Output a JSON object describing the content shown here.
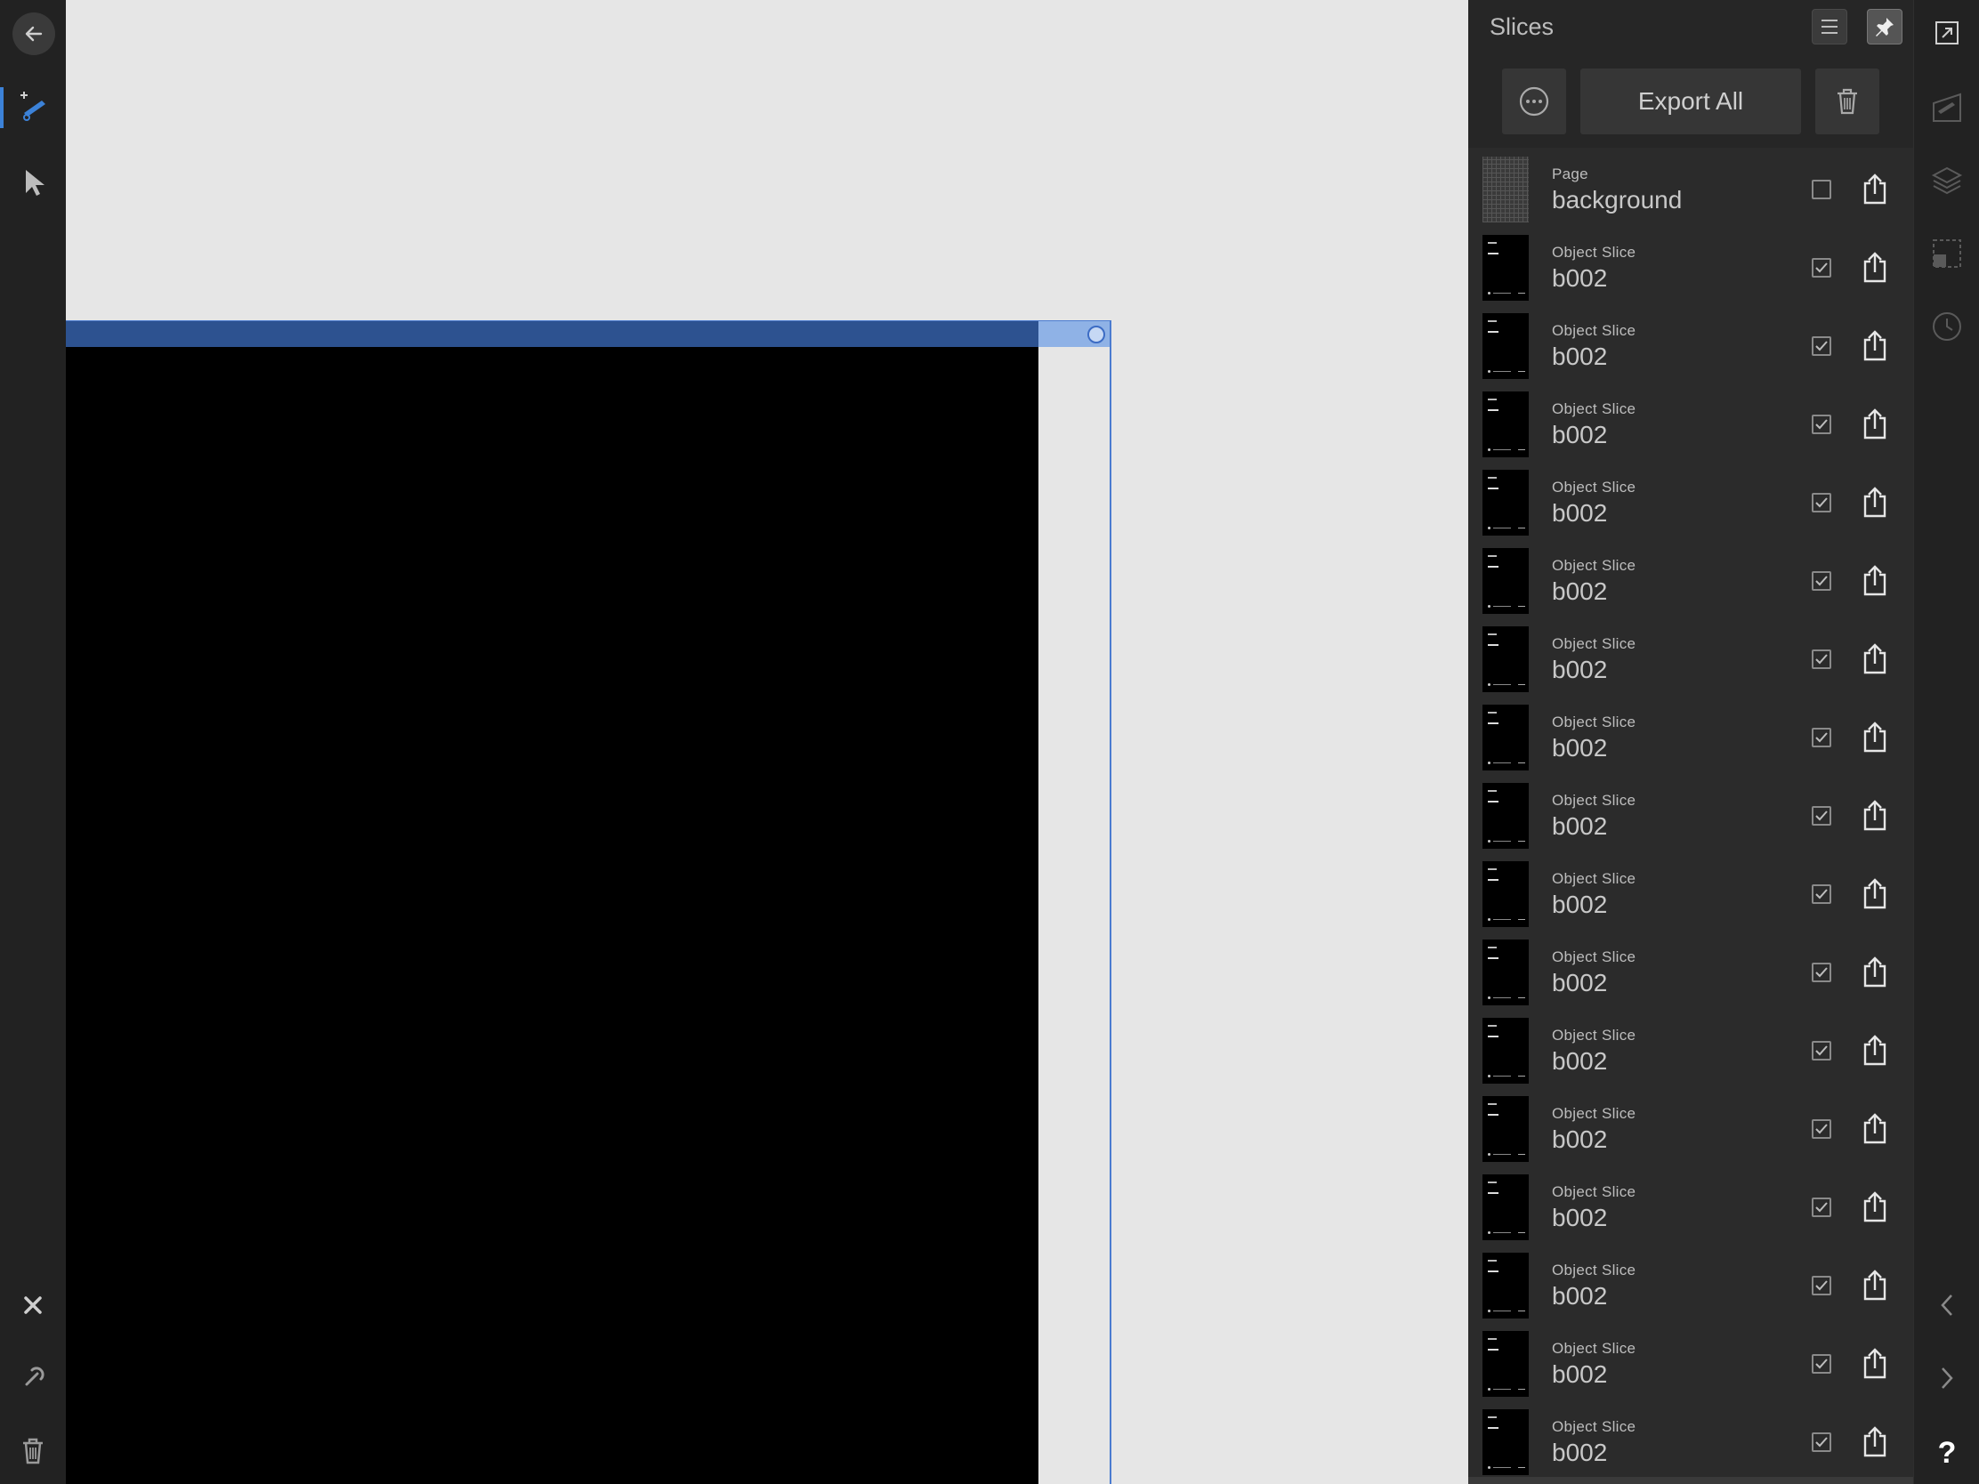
{
  "panel": {
    "title": "Slices",
    "export_all_label": "Export All"
  },
  "slices": [
    {
      "type": "Page",
      "name": "background",
      "checked": false
    },
    {
      "type": "Object Slice",
      "name": "b002",
      "checked": true
    },
    {
      "type": "Object Slice",
      "name": "b002",
      "checked": true
    },
    {
      "type": "Object Slice",
      "name": "b002",
      "checked": true
    },
    {
      "type": "Object Slice",
      "name": "b002",
      "checked": true
    },
    {
      "type": "Object Slice",
      "name": "b002",
      "checked": true
    },
    {
      "type": "Object Slice",
      "name": "b002",
      "checked": true
    },
    {
      "type": "Object Slice",
      "name": "b002",
      "checked": true
    },
    {
      "type": "Object Slice",
      "name": "b002",
      "checked": true
    },
    {
      "type": "Object Slice",
      "name": "b002",
      "checked": true
    },
    {
      "type": "Object Slice",
      "name": "b002",
      "checked": true
    },
    {
      "type": "Object Slice",
      "name": "b002",
      "checked": true
    },
    {
      "type": "Object Slice",
      "name": "b002",
      "checked": true
    },
    {
      "type": "Object Slice",
      "name": "b002",
      "checked": true
    },
    {
      "type": "Object Slice",
      "name": "b002",
      "checked": true
    },
    {
      "type": "Object Slice",
      "name": "b002",
      "checked": true
    },
    {
      "type": "Object Slice",
      "name": "b002",
      "checked": true
    }
  ],
  "studio": {
    "help_label": "?"
  },
  "colors": {
    "toolbar_bg": "#222222",
    "panel_bg": "#2b2b2b",
    "canvas_bg": "#e6e6e6",
    "selection_blue": "#2d5290",
    "accent_cyan": "#3fb6d8"
  }
}
